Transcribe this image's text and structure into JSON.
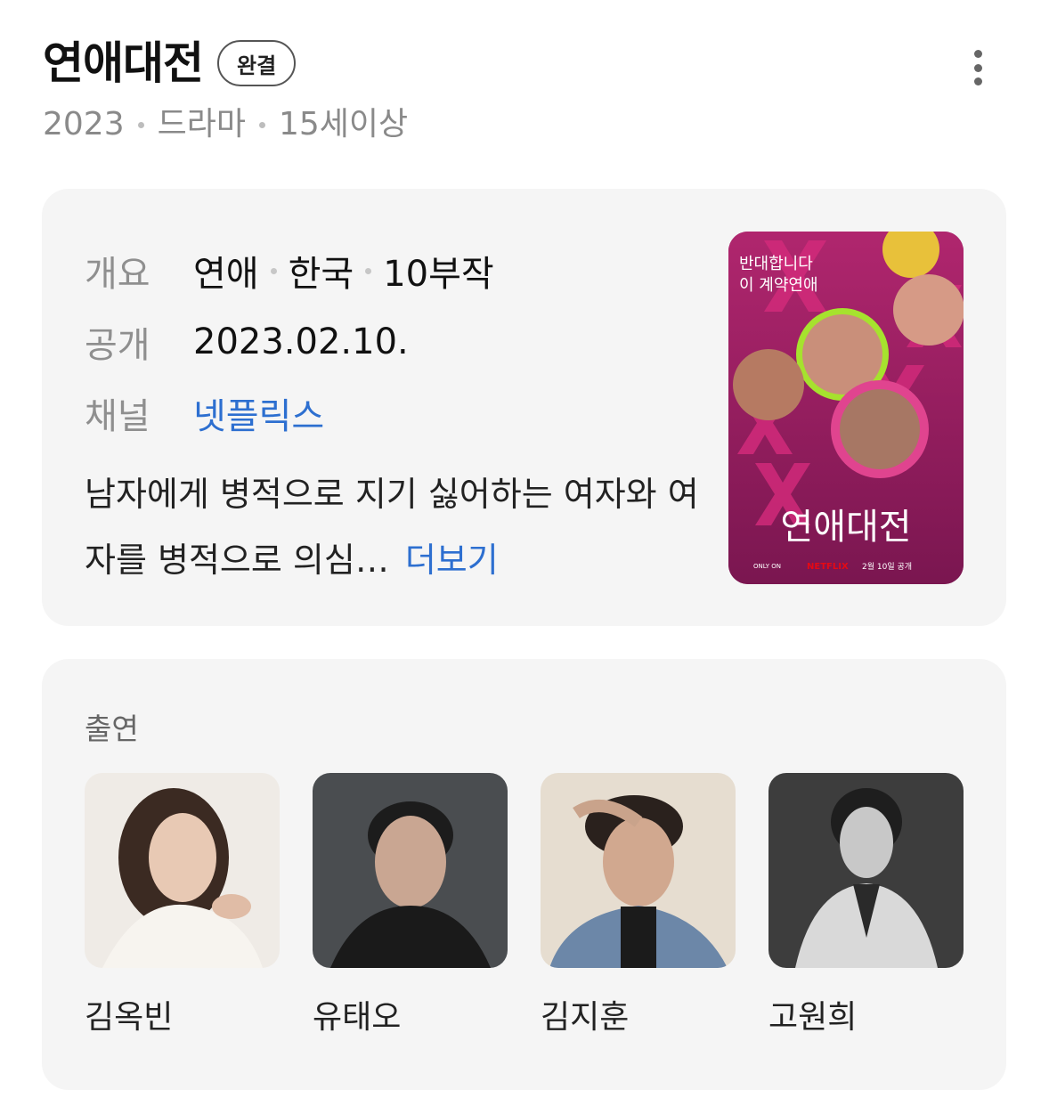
{
  "title": "연애대전",
  "status_badge": "완결",
  "meta": {
    "year": "2023",
    "genre": "드라마",
    "rating": "15세이상"
  },
  "info": {
    "overview_label": "개요",
    "overview_values": [
      "연애",
      "한국",
      "10부작"
    ],
    "release_label": "공개",
    "release_value": "2023.02.10.",
    "channel_label": "채널",
    "channel_value": "넷플릭스",
    "synopsis": "남자에게 병적으로 지기 싫어하는 여자와 여자를 병적으로 의심…",
    "more_label": "더보기"
  },
  "poster": {
    "tagline_1": "반대합니다",
    "tagline_2": "이 계약연애",
    "title_art": "연애대전",
    "footer_left": "ONLY ON",
    "footer_brand": "NETFLIX",
    "footer_right": "2월 10일 공개",
    "colors": {
      "bg": "#8e1d5e",
      "cross": "#d12a7a",
      "accent_green": "#a6e22e",
      "accent_yellow": "#e8c13a"
    }
  },
  "cast": {
    "title": "출연",
    "members": [
      {
        "name": "김옥빈",
        "tone": "#ece6df"
      },
      {
        "name": "유태오",
        "tone": "#3a3d40"
      },
      {
        "name": "김지훈",
        "tone": "#e4dacb"
      },
      {
        "name": "고원희",
        "tone": "#3c3c3c"
      }
    ]
  }
}
